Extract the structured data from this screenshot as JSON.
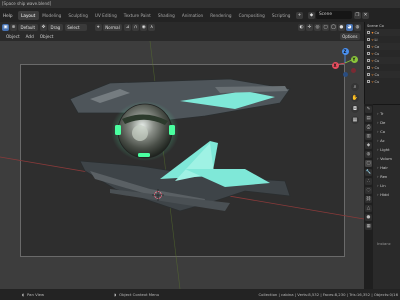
{
  "titlebar": {
    "title": "[Space ship wave.blend]"
  },
  "topbar": {
    "menus": [
      "Help"
    ],
    "tabs": [
      "Layout",
      "Modeling",
      "Sculpting",
      "UV Editing",
      "Texture Paint",
      "Shading",
      "Animation",
      "Rendering",
      "Compositing",
      "Scripting"
    ],
    "active_tab": "Layout",
    "scene_name": "Scene",
    "scene_icon": "scene-icon"
  },
  "vp_header": {
    "orientation_label": "Default",
    "drag_label": "Drag",
    "select_label": "Select Box",
    "transform_label": "Normal",
    "options_label": "Options"
  },
  "vp_menus": [
    "Object",
    "Add",
    "Object"
  ],
  "gizmo": {
    "x": "X",
    "y": "Y",
    "z": "Z"
  },
  "outliner": {
    "header_label": "Scene Co",
    "rows": [
      "Co",
      "Li",
      "Ca",
      "Cu",
      "Cu",
      "Cu",
      "Cu",
      "Cu"
    ]
  },
  "properties": {
    "rows": [
      "Tr",
      "De",
      "Co",
      "Ac",
      "Light",
      "Volum",
      "Hair",
      "Ren",
      "Lin",
      "Hidd"
    ],
    "footer_label": "Instanc"
  },
  "statusbar": {
    "left_label": "Pan View",
    "mid_label": "Object Context Menu",
    "stats": "Collection | cabina | Verts:8,532 | Faces:8,230 | Tris:16,352 | Objects:0/16"
  },
  "colors": {
    "accent_blue": "#4772b3",
    "glow_cyan": "#7fe8d8",
    "ship_metal": "#5a6066",
    "outliner_orange": "#f08a30"
  }
}
